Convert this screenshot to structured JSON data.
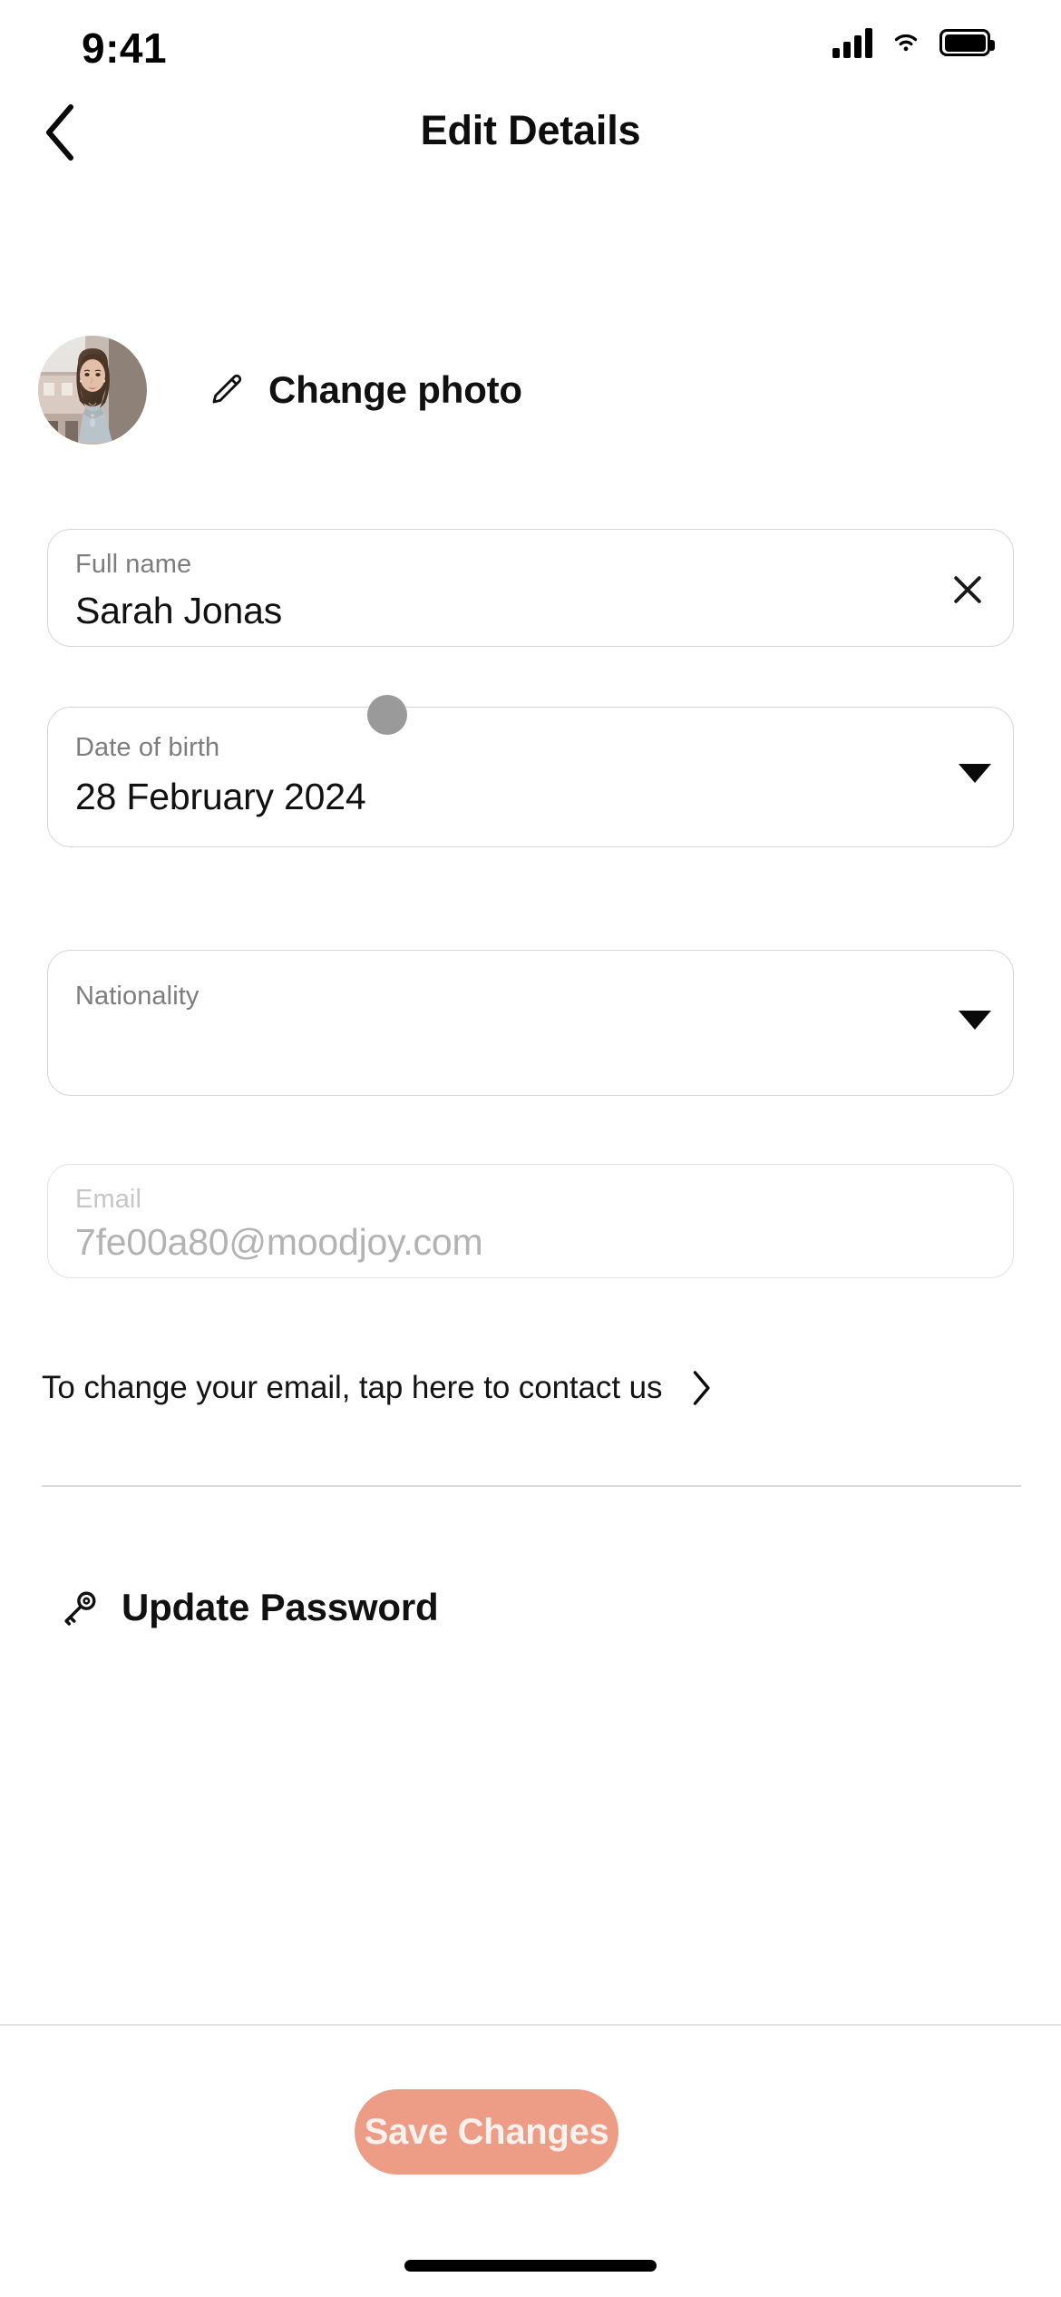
{
  "status_bar": {
    "time": "9:41",
    "icons": [
      "cellular-signal-icon",
      "wifi-icon",
      "battery-icon"
    ]
  },
  "header": {
    "title": "Edit Details",
    "back_icon": "chevron-left-icon"
  },
  "photo_section": {
    "avatar_alt": "profile-photo",
    "edit_icon": "pencil-icon",
    "change_photo_label": "Change photo"
  },
  "form": {
    "fields": [
      {
        "name": "full_name",
        "label": "Full name",
        "value": "Sarah Jonas",
        "placeholder": "Full name",
        "trailing_icon": "close-icon",
        "disabled": false
      },
      {
        "name": "date_of_birth",
        "label": "Date of birth",
        "value": "28 February 2024",
        "placeholder": "Date of birth",
        "trailing_icon": "chevron-down-icon",
        "disabled": false
      },
      {
        "name": "nationality",
        "label": "Nationality",
        "value": "",
        "placeholder": "Nationality",
        "trailing_icon": "chevron-down-icon",
        "disabled": false
      },
      {
        "name": "email",
        "label": "Email",
        "value": "7fe00a80@moodjoy.com",
        "placeholder": "Email",
        "trailing_icon": "",
        "disabled": true
      }
    ],
    "contact_row": {
      "label": "To change your email, tap here to contact us",
      "icon": "chevron-right-icon"
    }
  },
  "password_section": {
    "icon": "key-icon",
    "label": "Update Password"
  },
  "footer": {
    "save_label": "Save Changes",
    "save_color": "#ED9C86",
    "save_enabled": false
  }
}
